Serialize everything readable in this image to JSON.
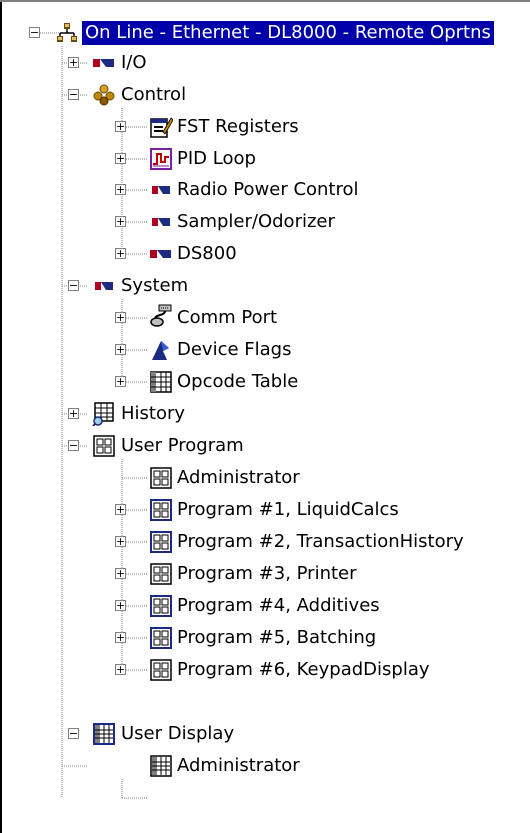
{
  "tree": {
    "root": {
      "label": "On Line - Ethernet - DL8000 - Remote Oprtns",
      "expanded": true,
      "selected": true,
      "icon": "network-root-icon"
    },
    "nodes": [
      {
        "label": "I/O",
        "icon": "io-module-icon",
        "expanded": false
      },
      {
        "label": "Control",
        "icon": "control-cluster-icon",
        "expanded": true
      },
      {
        "label": "FST Registers",
        "icon": "fst-registers-icon",
        "expanded": false
      },
      {
        "label": "PID Loop",
        "icon": "pid-loop-icon",
        "expanded": false
      },
      {
        "label": "Radio Power Control",
        "icon": "radio-power-icon",
        "expanded": false
      },
      {
        "label": "Sampler/Odorizer",
        "icon": "sampler-icon",
        "expanded": false
      },
      {
        "label": "DS800",
        "icon": "ds800-icon",
        "expanded": false
      },
      {
        "label": "System",
        "icon": "system-icon",
        "expanded": true
      },
      {
        "label": "Comm Port",
        "icon": "comm-port-icon",
        "expanded": false
      },
      {
        "label": "Device Flags",
        "icon": "device-flags-icon",
        "expanded": false
      },
      {
        "label": "Opcode Table",
        "icon": "opcode-table-icon",
        "expanded": false
      },
      {
        "label": "History",
        "icon": "history-icon",
        "expanded": false
      },
      {
        "label": "User Program",
        "icon": "user-program-icon",
        "expanded": true
      },
      {
        "label": "Administrator",
        "icon": "program-grid-icon",
        "expanded": null
      },
      {
        "label": "Program #1, LiquidCalcs",
        "icon": "program-grid-icon",
        "expanded": false
      },
      {
        "label": "Program #2, TransactionHistory",
        "icon": "program-grid-icon",
        "expanded": false
      },
      {
        "label": "Program #3, Printer",
        "icon": "program-grid-icon",
        "expanded": false
      },
      {
        "label": "Program #4, Additives",
        "icon": "program-grid-icon",
        "expanded": false
      },
      {
        "label": "Program #5, Batching",
        "icon": "program-grid-icon",
        "expanded": false
      },
      {
        "label": "Program #6, KeypadDisplay",
        "icon": "program-grid-icon",
        "expanded": false
      },
      {
        "label": "User Display",
        "icon": "user-display-icon",
        "expanded": true
      },
      {
        "label": "Administrator",
        "icon": "display-table-icon",
        "expanded": null
      }
    ]
  },
  "colors": {
    "selection_bg": "#0000a8",
    "selection_text": "#ffffff",
    "tree_line": "#808080",
    "io_red": "#b00020",
    "io_navy": "#1c2a80"
  }
}
